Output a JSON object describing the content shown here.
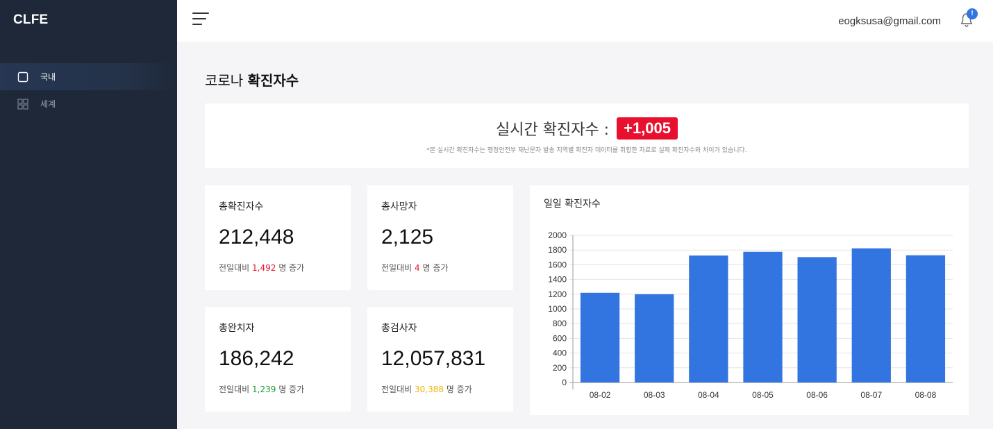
{
  "brand": "CLFE",
  "sidebar": {
    "items": [
      {
        "label": "국내",
        "icon": "square-icon",
        "active": true
      },
      {
        "label": "세계",
        "icon": "grid-icon",
        "active": false
      }
    ]
  },
  "header": {
    "user_email": "eogksusa@gmail.com",
    "notification_badge": "!"
  },
  "page": {
    "title_prefix": "코로나",
    "title_bold": "확진자수"
  },
  "realtime": {
    "label": "실시간 확진자수 :",
    "value": "+1,005",
    "note": "*본 실시간 확진자수는 행정안전부 재난문자 발송 지역별 확진자 데이터를 취합한 자료로 실제 확진자수와 차이가 있습니다."
  },
  "stats": [
    {
      "title": "총확진자수",
      "value": "212,448",
      "delta_prefix": "전일대비",
      "delta": "1,492",
      "delta_suffix": "명 증가",
      "delta_color": "#e8102e"
    },
    {
      "title": "총사망자",
      "value": "2,125",
      "delta_prefix": "전일대비",
      "delta": "4",
      "delta_suffix": "명 증가",
      "delta_color": "#e8102e"
    },
    {
      "title": "총완치자",
      "value": "186,242",
      "delta_prefix": "전일대비",
      "delta": "1,239",
      "delta_suffix": "명 증가",
      "delta_color": "#1a9b35"
    },
    {
      "title": "총검사자",
      "value": "12,057,831",
      "delta_prefix": "전일대비",
      "delta": "30,388",
      "delta_suffix": "명 증가",
      "delta_color": "#f0b400"
    }
  ],
  "colors": {
    "sidebar_bg": "#1e2838",
    "accent": "#3274e0",
    "alert": "#e8102e"
  },
  "chart_data": {
    "type": "bar",
    "title": "일일 확진자수",
    "categories": [
      "08-02",
      "08-03",
      "08-04",
      "08-05",
      "08-06",
      "08-07",
      "08-08"
    ],
    "values": [
      1219,
      1200,
      1725,
      1776,
      1704,
      1823,
      1729
    ],
    "ylim": [
      0,
      2000
    ],
    "yticks": [
      0,
      200,
      400,
      600,
      800,
      1000,
      1200,
      1400,
      1600,
      1800,
      2000
    ],
    "grid": true,
    "bar_color": "#3274e0"
  }
}
